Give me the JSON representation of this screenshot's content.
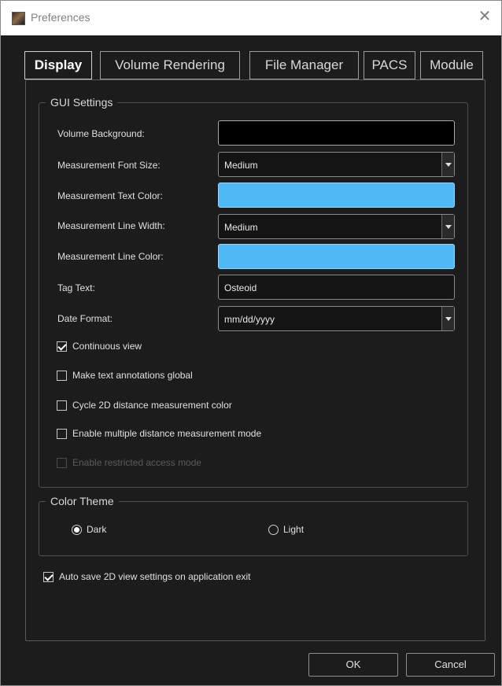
{
  "window": {
    "title": "Preferences",
    "app_icon": "app-logo-icon",
    "close_icon": "close-icon",
    "close_glyph": "✕"
  },
  "tabs": [
    {
      "label": "Display",
      "active": true
    },
    {
      "label": "Volume Rendering",
      "active": false
    },
    {
      "label": "File Manager",
      "active": false
    },
    {
      "label": "PACS",
      "active": false
    },
    {
      "label": "Module",
      "active": false
    }
  ],
  "gui_settings": {
    "legend": "GUI Settings",
    "volume_background": {
      "label": "Volume Background:",
      "color": "#000000"
    },
    "font_size": {
      "label": "Measurement Font Size:",
      "value": "Medium"
    },
    "text_color": {
      "label": "Measurement Text Color:",
      "color": "#4fb9f5"
    },
    "line_width": {
      "label": "Measurement Line Width:",
      "value": "Medium"
    },
    "line_color": {
      "label": "Measurement Line Color:",
      "color": "#4fb9f5"
    },
    "tag_text": {
      "label": "Tag Text:",
      "value": "Osteoid"
    },
    "date_format": {
      "label": "Date Format:",
      "value": "mm/dd/yyyy"
    },
    "checkboxes": [
      {
        "label": "Continuous view",
        "checked": true,
        "enabled": true
      },
      {
        "label": "Make text annotations global",
        "checked": false,
        "enabled": true
      },
      {
        "label": "Cycle 2D distance measurement color",
        "checked": false,
        "enabled": true
      },
      {
        "label": "Enable multiple distance measurement mode",
        "checked": false,
        "enabled": true
      },
      {
        "label": "Enable restricted access mode",
        "checked": false,
        "enabled": false
      }
    ]
  },
  "color_theme": {
    "legend": "Color Theme",
    "options": [
      {
        "label": "Dark",
        "selected": true
      },
      {
        "label": "Light",
        "selected": false
      }
    ]
  },
  "auto_save": {
    "label": "Auto save 2D view settings on application exit",
    "checked": true
  },
  "buttons": {
    "ok": "OK",
    "cancel": "Cancel"
  },
  "colors": {
    "background": "#1c1c1c",
    "accent_blue": "#4fb9f5",
    "border": "#8a8a8a"
  }
}
